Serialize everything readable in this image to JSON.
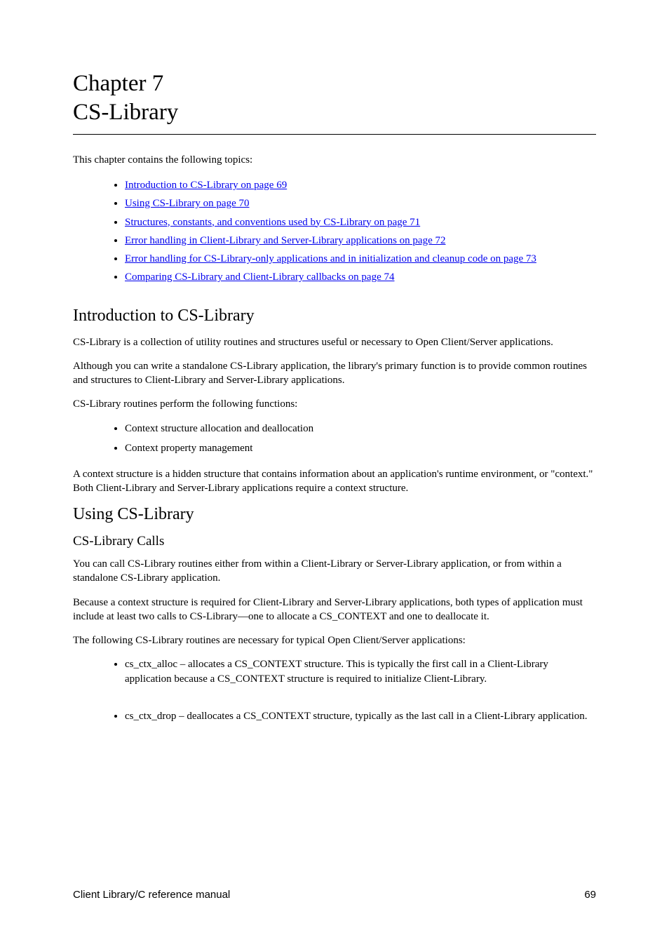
{
  "chapter": {
    "label": "Chapter   7",
    "title": "CS-Library"
  },
  "intro": {
    "lead": "This chapter contains the following topics:",
    "toc": [
      "Introduction to CS-Library  on page 69",
      "Using CS-Library  on page 70",
      "Structures, constants, and conventions used by CS-Library  on page 71",
      "Error handling in Client-Library and Server-Library applications  on page 72",
      "Error handling for CS-Library-only applications and in initialization and cleanup code  on page 73",
      "Comparing CS-Library and Client-Library callbacks  on page 74"
    ]
  },
  "section1": {
    "heading": "Introduction to CS-Library",
    "p1": "CS-Library is a collection of utility routines and structures useful or necessary to Open Client/Server applications.",
    "p2": "Although you can write a standalone CS-Library application, the library's primary function is to provide common routines and structures to Client-Library and Server-Library applications.",
    "p3": "CS-Library routines perform the following functions:",
    "bullets": [
      "Context structure allocation and deallocation",
      "Context property management"
    ],
    "p4": "A context structure is a hidden structure that contains information about an application's runtime environment, or \"context.\" Both Client-Library and Server-Library applications require a context structure."
  },
  "section2": {
    "heading": "Using CS-Library",
    "subheading": "CS-Library Calls",
    "p1": "You can call CS-Library routines either from within a Client-Library or Server-Library application, or from within a standalone CS-Library application.",
    "p2": "Because a context structure is required for Client-Library and Server-Library applications, both types of application must include at least two calls to CS-Library—one to allocate a CS_CONTEXT and one to deallocate it.",
    "p3": "The following CS-Library routines are necessary for typical Open Client/Server applications:",
    "bullets2": [
      "cs_ctx_alloc – allocates a CS_CONTEXT structure. This is typically the first call in a Client-Library application because a CS_CONTEXT structure is required to initialize Client-Library.",
      "cs_ctx_drop – deallocates a CS_CONTEXT structure, typically as the last call in a Client-Library application."
    ]
  },
  "footer": {
    "left": "Client Library/C reference manual",
    "right": "69"
  }
}
